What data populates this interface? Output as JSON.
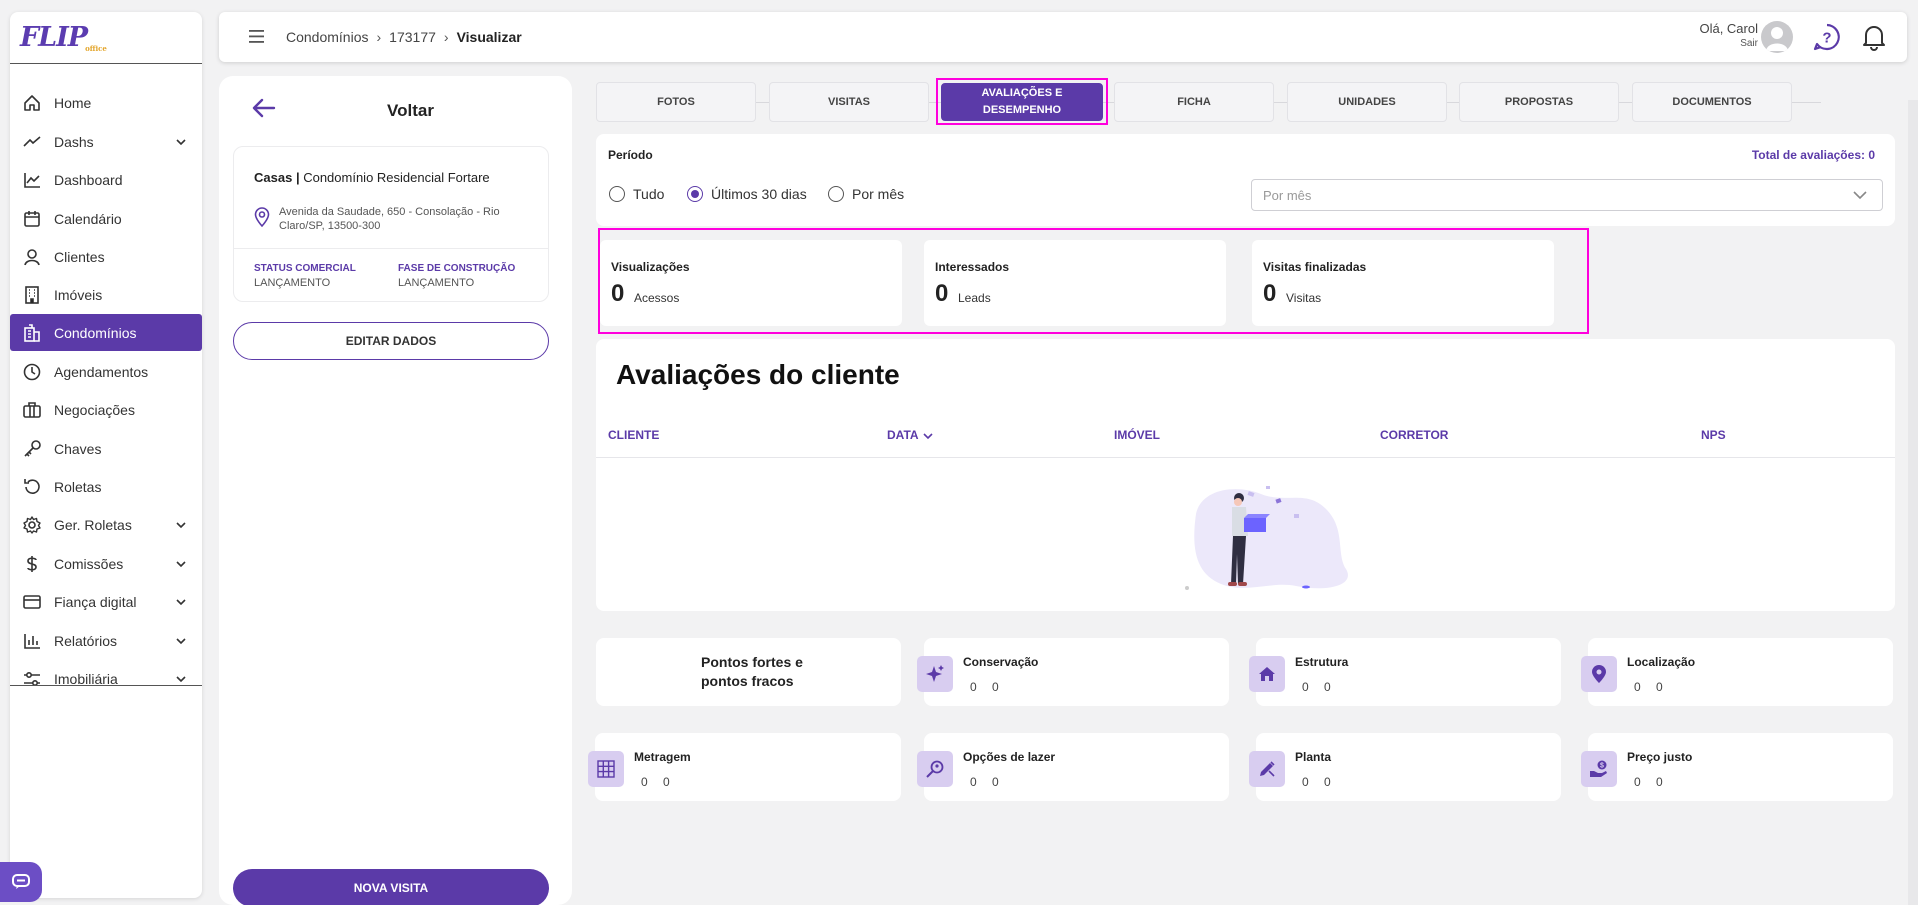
{
  "app": {
    "logo": "FLIP",
    "logo_sub": "office"
  },
  "sidebar": {
    "items": [
      {
        "label": "Home",
        "icon": "home-icon"
      },
      {
        "label": "Dashs",
        "icon": "trending-icon",
        "expandable": true
      },
      {
        "label": "Dashboard",
        "icon": "chart-line-icon"
      },
      {
        "label": "Calendário",
        "icon": "calendar-icon"
      },
      {
        "label": "Clientes",
        "icon": "user-icon"
      },
      {
        "label": "Imóveis",
        "icon": "building-icon"
      },
      {
        "label": "Condomínios",
        "icon": "buildings-icon",
        "active": true
      },
      {
        "label": "Agendamentos",
        "icon": "clock-icon"
      },
      {
        "label": "Negociações",
        "icon": "briefcase-icon"
      },
      {
        "label": "Chaves",
        "icon": "key-icon"
      },
      {
        "label": "Roletas",
        "icon": "rotate-icon"
      },
      {
        "label": "Ger. Roletas",
        "icon": "gear-icon",
        "expandable": true
      },
      {
        "label": "Comissões",
        "icon": "dollar-icon",
        "expandable": true
      },
      {
        "label": "Fiança digital",
        "icon": "credit-card-icon",
        "expandable": true
      },
      {
        "label": "Relatórios",
        "icon": "bar-chart-icon",
        "expandable": true
      },
      {
        "label": "Imobiliária",
        "icon": "sliders-icon",
        "expandable": true
      }
    ]
  },
  "header": {
    "breadcrumb": [
      "Condomínios",
      "173177",
      "Visualizar"
    ],
    "greeting": "Olá, Carol",
    "logout": "Sair"
  },
  "left_panel": {
    "back_label": "Voltar",
    "property_type": "Casas",
    "property_name": "Condomínio Residencial Fortare",
    "address_line1": "Avenida da Saudade, 650 - Consolação - Rio",
    "address_line2": "Claro/SP, 13500-300",
    "status_label": "STATUS COMERCIAL",
    "status_value": "LANÇAMENTO",
    "phase_label": "FASE DE CONSTRUÇÃO",
    "phase_value": "LANÇAMENTO",
    "edit_button": "EDITAR DADOS",
    "new_visit_button": "NOVA VISITA"
  },
  "tabs": [
    {
      "label": "FOTOS"
    },
    {
      "label": "VISITAS"
    },
    {
      "label": "AVALIAÇÕES E DESEMPENHO",
      "active": true
    },
    {
      "label": "FICHA"
    },
    {
      "label": "UNIDADES"
    },
    {
      "label": "PROPOSTAS"
    },
    {
      "label": "DOCUMENTOS"
    }
  ],
  "period": {
    "title": "Período",
    "total_label": "Total de avaliações: 0",
    "options": [
      "Tudo",
      "Últimos 30 dias",
      "Por mês"
    ],
    "selected": "Últimos 30 dias",
    "month_placeholder": "Por mês"
  },
  "stats": [
    {
      "title": "Visualizações",
      "value": "0",
      "unit": "Acessos"
    },
    {
      "title": "Interessados",
      "value": "0",
      "unit": "Leads"
    },
    {
      "title": "Visitas finalizadas",
      "value": "0",
      "unit": "Visitas"
    }
  ],
  "reviews": {
    "title": "Avaliações do cliente",
    "columns": [
      "CLIENTE",
      "DATA",
      "IMÓVEL",
      "CORRETOR",
      "NPS"
    ]
  },
  "points": {
    "title_line1": "Pontos fortes e",
    "title_line2": "pontos fracos",
    "items": [
      {
        "label": "Conservação",
        "v1": "0",
        "v2": "0",
        "icon": "sparkles-icon"
      },
      {
        "label": "Estrutura",
        "v1": "0",
        "v2": "0",
        "icon": "house-icon"
      },
      {
        "label": "Localização",
        "v1": "0",
        "v2": "0",
        "icon": "map-pin-icon"
      },
      {
        "label": "Metragem",
        "v1": "0",
        "v2": "0",
        "icon": "grid-icon"
      },
      {
        "label": "Opções de lazer",
        "v1": "0",
        "v2": "0",
        "icon": "search-person-icon"
      },
      {
        "label": "Planta",
        "v1": "0",
        "v2": "0",
        "icon": "pencil-ruler-icon"
      },
      {
        "label": "Preço justo",
        "v1": "0",
        "v2": "0",
        "icon": "hand-coin-icon"
      }
    ]
  },
  "colors": {
    "primary": "#5b3aa8",
    "highlight": "#ff00dd",
    "icon_bg": "#d8cdf0"
  }
}
